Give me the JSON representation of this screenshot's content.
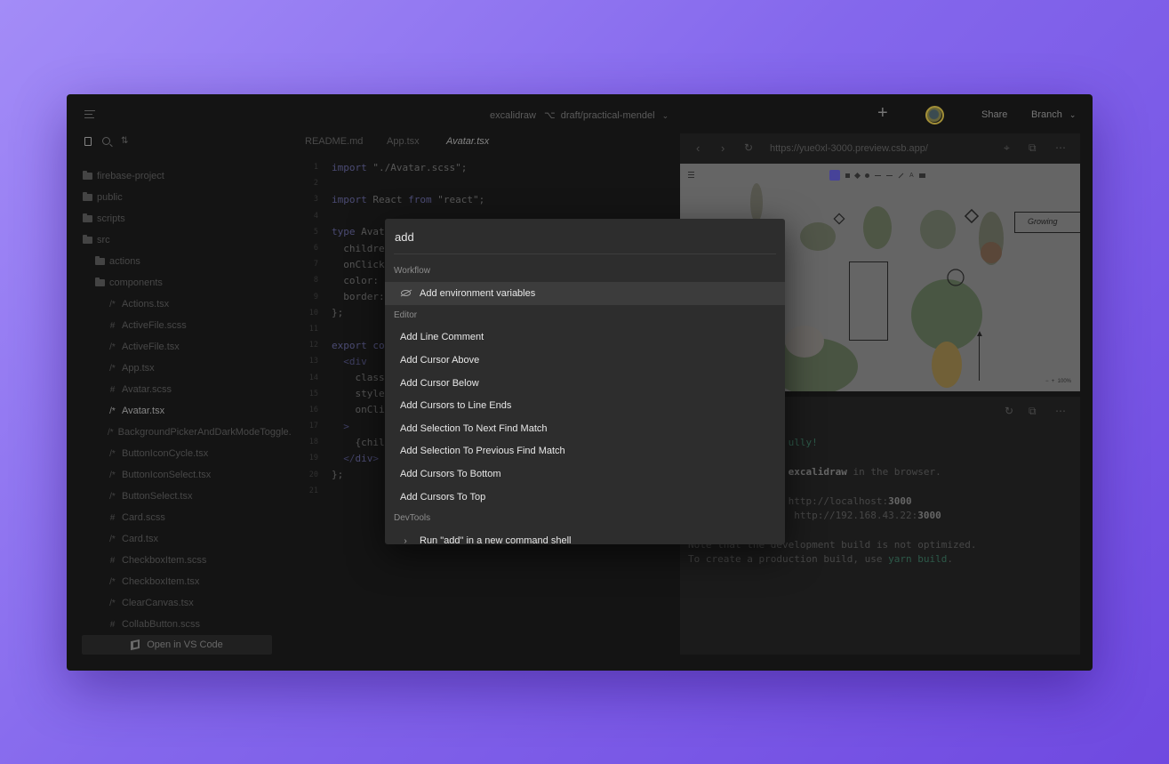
{
  "topbar": {
    "project": "excalidraw",
    "branch_glyph": "⌥",
    "branch_path": "draft/practical-mendel",
    "plus": "+",
    "share": "Share",
    "branch": "Branch"
  },
  "sidebar": {
    "tree": [
      {
        "label": "firebase-project",
        "type": "folder",
        "indent": 0
      },
      {
        "label": "public",
        "type": "folder",
        "indent": 0
      },
      {
        "label": "scripts",
        "type": "folder",
        "indent": 0
      },
      {
        "label": "src",
        "type": "folder-open",
        "indent": 0
      },
      {
        "label": "actions",
        "type": "folder",
        "indent": 1
      },
      {
        "label": "components",
        "type": "folder-open",
        "indent": 1
      },
      {
        "label": "Actions.tsx",
        "type": "tsx",
        "indent": 2
      },
      {
        "label": "ActiveFile.scss",
        "type": "scss",
        "indent": 2
      },
      {
        "label": "ActiveFile.tsx",
        "type": "tsx",
        "indent": 2
      },
      {
        "label": "App.tsx",
        "type": "tsx",
        "indent": 2
      },
      {
        "label": "Avatar.scss",
        "type": "scss",
        "indent": 2
      },
      {
        "label": "Avatar.tsx",
        "type": "tsx",
        "indent": 2,
        "active": true
      },
      {
        "label": "BackgroundPickerAndDarkModeToggle.tsx",
        "type": "tsx",
        "indent": 2
      },
      {
        "label": "ButtonIconCycle.tsx",
        "type": "tsx",
        "indent": 2
      },
      {
        "label": "ButtonIconSelect.tsx",
        "type": "tsx",
        "indent": 2
      },
      {
        "label": "ButtonSelect.tsx",
        "type": "tsx",
        "indent": 2
      },
      {
        "label": "Card.scss",
        "type": "scss",
        "indent": 2
      },
      {
        "label": "Card.tsx",
        "type": "tsx",
        "indent": 2
      },
      {
        "label": "CheckboxItem.scss",
        "type": "scss",
        "indent": 2
      },
      {
        "label": "CheckboxItem.tsx",
        "type": "tsx",
        "indent": 2
      },
      {
        "label": "ClearCanvas.tsx",
        "type": "tsx",
        "indent": 2
      },
      {
        "label": "CollabButton.scss",
        "type": "scss",
        "indent": 2
      }
    ],
    "open_vscode": "Open in VS Code"
  },
  "editor": {
    "tabs": [
      "README.md",
      "App.tsx",
      "Avatar.tsx"
    ],
    "active_tab": "Avatar.tsx",
    "lines": [
      {
        "n": "1",
        "parts": [
          [
            "kw",
            "import "
          ],
          [
            "str",
            "\"./Avatar.scss\";"
          ]
        ]
      },
      {
        "n": "2",
        "parts": []
      },
      {
        "n": "3",
        "parts": [
          [
            "kw",
            "import "
          ],
          [
            "id",
            "React "
          ],
          [
            "kw",
            "from "
          ],
          [
            "str",
            "\"react\";"
          ]
        ]
      },
      {
        "n": "4",
        "parts": []
      },
      {
        "n": "5",
        "parts": [
          [
            "kw",
            "type "
          ],
          [
            "id",
            "Avatar"
          ]
        ]
      },
      {
        "n": "6",
        "parts": [
          [
            "id",
            "  children"
          ]
        ]
      },
      {
        "n": "7",
        "parts": [
          [
            "id",
            "  onClick"
          ]
        ]
      },
      {
        "n": "8",
        "parts": [
          [
            "id",
            "  color: "
          ]
        ]
      },
      {
        "n": "9",
        "parts": [
          [
            "id",
            "  border:"
          ]
        ]
      },
      {
        "n": "10",
        "parts": [
          [
            "id",
            "};"
          ]
        ]
      },
      {
        "n": "11",
        "parts": []
      },
      {
        "n": "12",
        "parts": [
          [
            "kw",
            "export "
          ],
          [
            "kw",
            "co"
          ]
        ]
      },
      {
        "n": "13",
        "parts": [
          [
            "tag",
            "  <div"
          ]
        ]
      },
      {
        "n": "14",
        "parts": [
          [
            "id",
            "    class"
          ]
        ]
      },
      {
        "n": "15",
        "parts": [
          [
            "id",
            "    style"
          ]
        ]
      },
      {
        "n": "16",
        "parts": [
          [
            "id",
            "    onCli"
          ]
        ]
      },
      {
        "n": "17",
        "parts": [
          [
            "tag",
            "  >"
          ]
        ]
      },
      {
        "n": "18",
        "parts": [
          [
            "id",
            "    {chil"
          ]
        ]
      },
      {
        "n": "19",
        "parts": [
          [
            "tag",
            "  </"
          ],
          [
            "kw",
            "div"
          ],
          [
            "tag",
            ">"
          ]
        ]
      },
      {
        "n": "20",
        "parts": [
          [
            "id",
            "};"
          ]
        ]
      },
      {
        "n": "21",
        "parts": []
      }
    ]
  },
  "preview": {
    "url": "https://yue0xl-3000.preview.csb.app/",
    "canvas_label": "Growing",
    "zoom": "100%"
  },
  "terminal": {
    "lines": [
      [
        [
          "green",
          "                 ully!"
        ]
      ],
      [
        [
          "plain",
          ""
        ]
      ],
      [
        [
          "plain",
          "                 "
        ],
        [
          "bold",
          "excalidraw"
        ],
        [
          "plain",
          " in the browser."
        ]
      ],
      [
        [
          "plain",
          ""
        ]
      ],
      [
        [
          "plain",
          "                 http://localhost:"
        ],
        [
          "bold",
          "3000"
        ]
      ],
      [
        [
          "plain",
          "               :  http://192.168.43.22:"
        ],
        [
          "bold",
          "3000"
        ]
      ],
      [
        [
          "plain",
          ""
        ]
      ],
      [
        [
          "plain",
          "Note that the development build is not optimized."
        ]
      ],
      [
        [
          "plain",
          "To create a production build, use "
        ],
        [
          "green",
          "yarn build"
        ],
        [
          "plain",
          "."
        ]
      ]
    ]
  },
  "palette": {
    "query": "add",
    "groups": [
      {
        "label": "Workflow",
        "items": [
          {
            "label": "Add environment variables",
            "icon": "eye-slash-icon",
            "selected": true
          }
        ]
      },
      {
        "label": "Editor",
        "items": [
          {
            "label": "Add Line Comment"
          },
          {
            "label": "Add Cursor Above"
          },
          {
            "label": "Add Cursor Below"
          },
          {
            "label": "Add Cursors to Line Ends"
          },
          {
            "label": "Add Selection To Next Find Match"
          },
          {
            "label": "Add Selection To Previous Find Match"
          },
          {
            "label": "Add Cursors To Bottom"
          },
          {
            "label": "Add Cursors To Top"
          }
        ]
      },
      {
        "label": "DevTools",
        "items": [
          {
            "label": "Run \"add\" in a new command shell",
            "icon": "chevron-right-icon"
          }
        ]
      }
    ]
  }
}
